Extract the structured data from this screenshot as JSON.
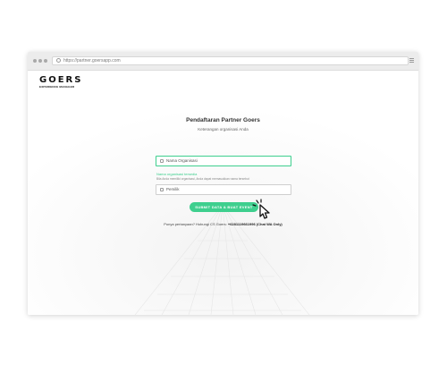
{
  "browser": {
    "url": "https://partner.goersapp.com"
  },
  "logo": {
    "name": "GOERS",
    "tagline": "EXPERIENCE MANAGER"
  },
  "form": {
    "title": "Pendaftaran Partner Goers",
    "subtitle": "Keterangan organisasi Anda",
    "organization_field": {
      "value": "Nama Organisasi"
    },
    "organization_valid": "Nama organisasi tersedia",
    "organization_help": "Bila Anda memiliki organisasi, Anda dapat memasukkan nama tersebut",
    "owner_field": {
      "value": "Pemilik"
    },
    "submit_label": "SUBMIT DATA & BUAT EVENT",
    "help_prefix": "Punya pertanyaan? Hubungi CS Goers:",
    "help_contact": "+6281119661996 (Chat WA Only)"
  },
  "colors": {
    "accent": "#3ecf8e",
    "chrome": "#ececec"
  }
}
